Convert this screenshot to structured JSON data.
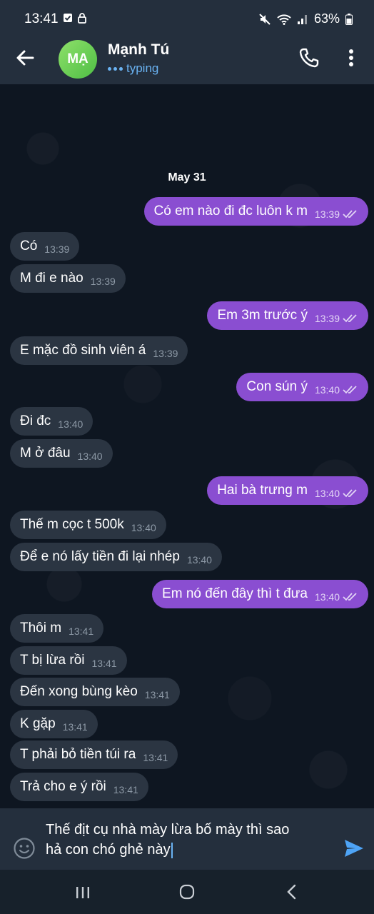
{
  "status_bar": {
    "time": "13:41",
    "battery": "63%"
  },
  "header": {
    "avatar_initials": "MẠ",
    "contact_name": "Mạnh Tú",
    "status": "typing"
  },
  "chat": {
    "date": "May 31",
    "messages": [
      {
        "dir": "out",
        "text": "Có em nào đi đc luôn k m",
        "time": "13:39"
      },
      {
        "dir": "in",
        "text": "Có",
        "time": "13:39"
      },
      {
        "dir": "in",
        "text": "M đi e nào",
        "time": "13:39"
      },
      {
        "dir": "out",
        "text": "Em 3m trước ý",
        "time": "13:39"
      },
      {
        "dir": "in",
        "text": "E mặc đồ sinh viên á",
        "time": "13:39"
      },
      {
        "dir": "out",
        "text": "Con sún ý",
        "time": "13:40"
      },
      {
        "dir": "in",
        "text": "Đi đc",
        "time": "13:40"
      },
      {
        "dir": "in",
        "text": "M ở đâu",
        "time": "13:40"
      },
      {
        "dir": "out",
        "text": "Hai bà trưng m",
        "time": "13:40"
      },
      {
        "dir": "in",
        "text": "Thế m cọc t 500k",
        "time": "13:40"
      },
      {
        "dir": "in",
        "text": "Để e nó lấy tiền đi lại nhép",
        "time": "13:40"
      },
      {
        "dir": "out",
        "text": "Em nó đến đây thì t đưa",
        "time": "13:40"
      },
      {
        "dir": "in",
        "text": "Thôi m",
        "time": "13:41"
      },
      {
        "dir": "in",
        "text": "T bị lừa rồi",
        "time": "13:41"
      },
      {
        "dir": "in",
        "text": "Đến xong bùng kèo",
        "time": "13:41"
      },
      {
        "dir": "in",
        "text": "K gặp",
        "time": "13:41"
      },
      {
        "dir": "in",
        "text": "T phải bỏ tiền túi ra",
        "time": "13:41"
      },
      {
        "dir": "in",
        "text": "Trả cho e ý rồi",
        "time": "13:41"
      }
    ]
  },
  "composer": {
    "line1": "Thế địt cụ nhà mày lừa bố mày thì sao",
    "line2": "hả con chó ghẻ này"
  },
  "colors": {
    "outgoing_bubble": "#8a4ed1",
    "incoming_bubble": "#2b3542",
    "accent": "#6ab3f3",
    "avatar": "#5fcb4f"
  }
}
